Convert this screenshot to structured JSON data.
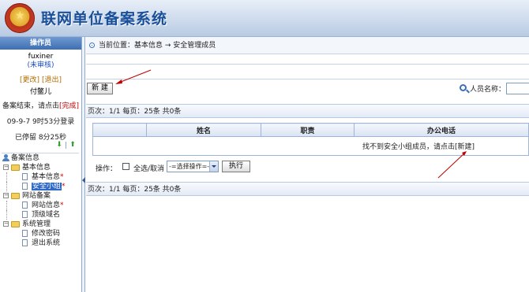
{
  "header": {
    "title": "联网单位备案系统"
  },
  "sidebar": {
    "heading": "操作员",
    "username": "fuxiner",
    "status": "(未审核)",
    "link_password": "[更改]",
    "link_logout": "[退出]",
    "real_name": "付鳖儿",
    "end_prompt": "备案结束，请点击",
    "end_link": "[完成]",
    "login_time": "09-9-7 9时53分登录",
    "stay_time": "已停留  8分25秒",
    "tree": {
      "root": "备案信息",
      "groups": [
        {
          "label": "基本信息",
          "items": [
            {
              "label": "基本信息",
              "star": "*"
            },
            {
              "label": "安全小组",
              "star": "*"
            }
          ]
        },
        {
          "label": "网站备案",
          "items": [
            {
              "label": "网站信息",
              "star": "*"
            },
            {
              "label": "顶级域名",
              "star": ""
            }
          ]
        },
        {
          "label": "系统管理",
          "items": [
            {
              "label": "修改密码",
              "star": ""
            },
            {
              "label": "退出系统",
              "star": ""
            }
          ]
        }
      ]
    }
  },
  "breadcrumb": {
    "text": "当前位置：基本信息 → 安全管理成员"
  },
  "toolbar": {
    "new_label": "新  建",
    "search_label": "人员名称：",
    "search_value": ""
  },
  "pager": {
    "text": "页次：1/1 每页：25条 共0条"
  },
  "table": {
    "columns": [
      "",
      "姓名",
      "职责",
      "办公电话"
    ],
    "empty_text": "找不到安全小组成员，请点击",
    "empty_link": "[新建]"
  },
  "ops": {
    "label": "操作：",
    "select_all": "全选/取消",
    "action_select": "-=选择操作=-",
    "execute_label": "执行"
  },
  "colors": {
    "accent": "#1a4f9a",
    "annotation": "#c00000"
  }
}
